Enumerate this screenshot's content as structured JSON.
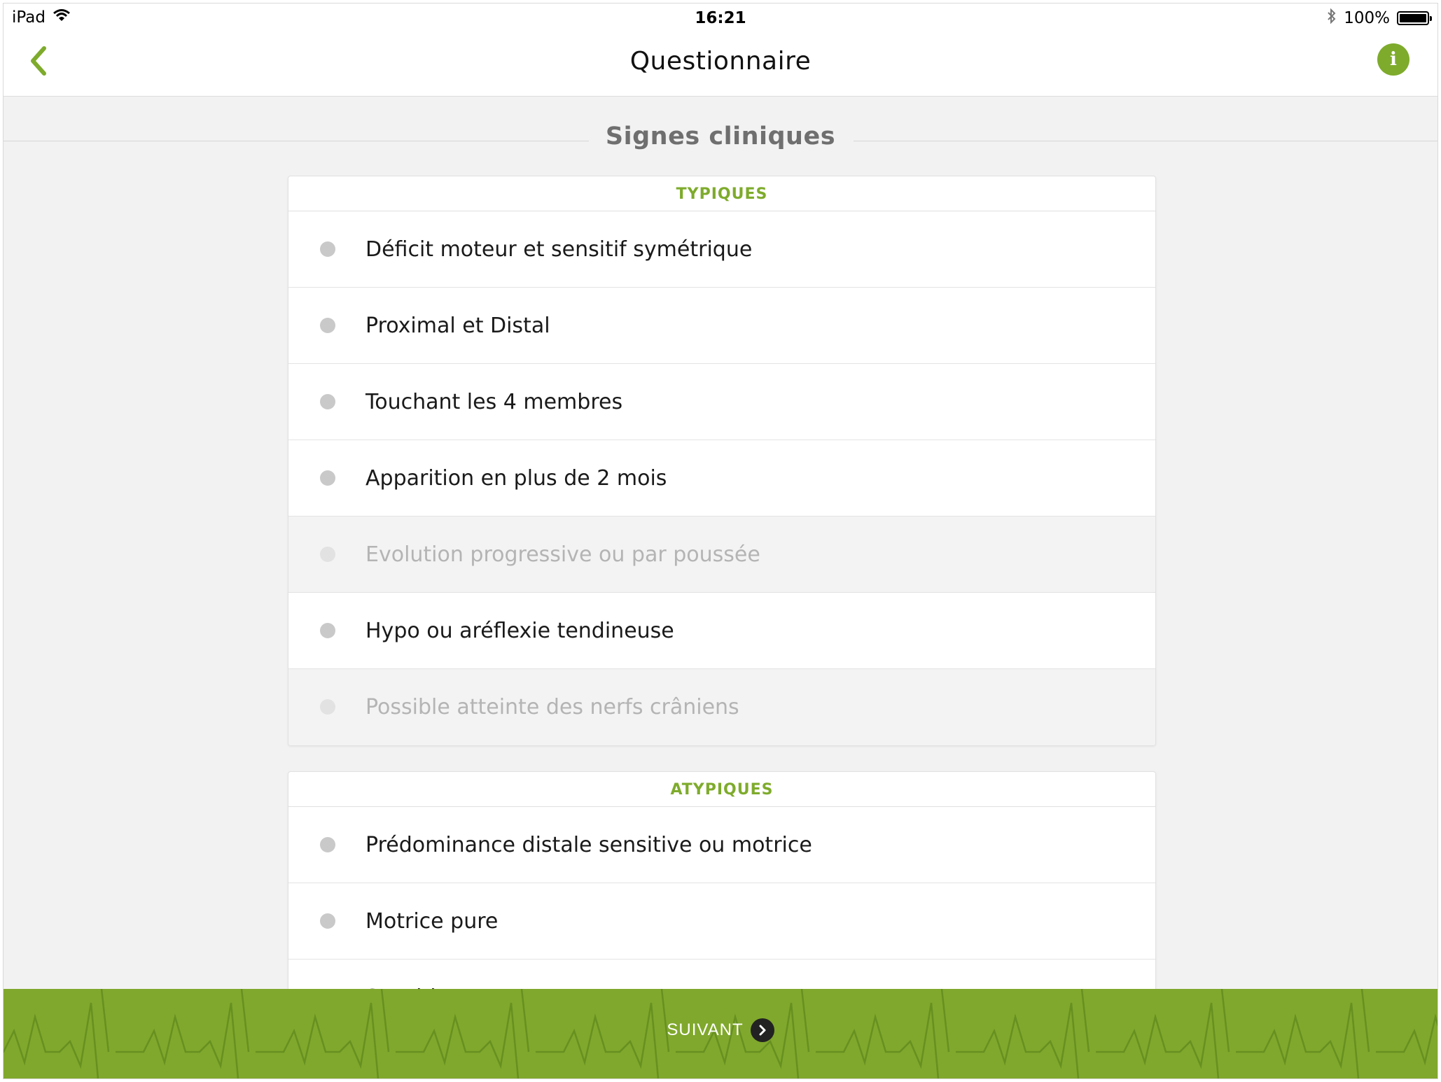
{
  "status_bar": {
    "device": "iPad",
    "time": "16:21",
    "battery": "100%",
    "battery_level": 1.0
  },
  "nav": {
    "title": "Questionnaire",
    "back_icon": "chevron-left-icon",
    "info_label": "i"
  },
  "section": {
    "title": "Signes cliniques"
  },
  "groups": [
    {
      "header": "TYPIQUES",
      "items": [
        {
          "label": "Déficit moteur et sensitif symétrique",
          "enabled": true
        },
        {
          "label": "Proximal et Distal",
          "enabled": true
        },
        {
          "label": "Touchant les 4 membres",
          "enabled": true
        },
        {
          "label": "Apparition en plus de 2 mois",
          "enabled": true
        },
        {
          "label": "Evolution progressive ou par poussée",
          "enabled": false
        },
        {
          "label": "Hypo ou aréflexie tendineuse",
          "enabled": true
        },
        {
          "label": "Possible atteinte des nerfs crâniens",
          "enabled": false
        }
      ]
    },
    {
      "header": "ATYPIQUES",
      "items": [
        {
          "label": "Prédominance distale sensitive ou motrice",
          "enabled": true
        },
        {
          "label": "Motrice pure",
          "enabled": true
        },
        {
          "label": "Sensitive pure",
          "enabled": true
        }
      ]
    }
  ],
  "footer": {
    "next_label": "SUIVANT"
  },
  "colors": {
    "accent": "#7eab2c",
    "footer_bg": "#80a82c"
  }
}
